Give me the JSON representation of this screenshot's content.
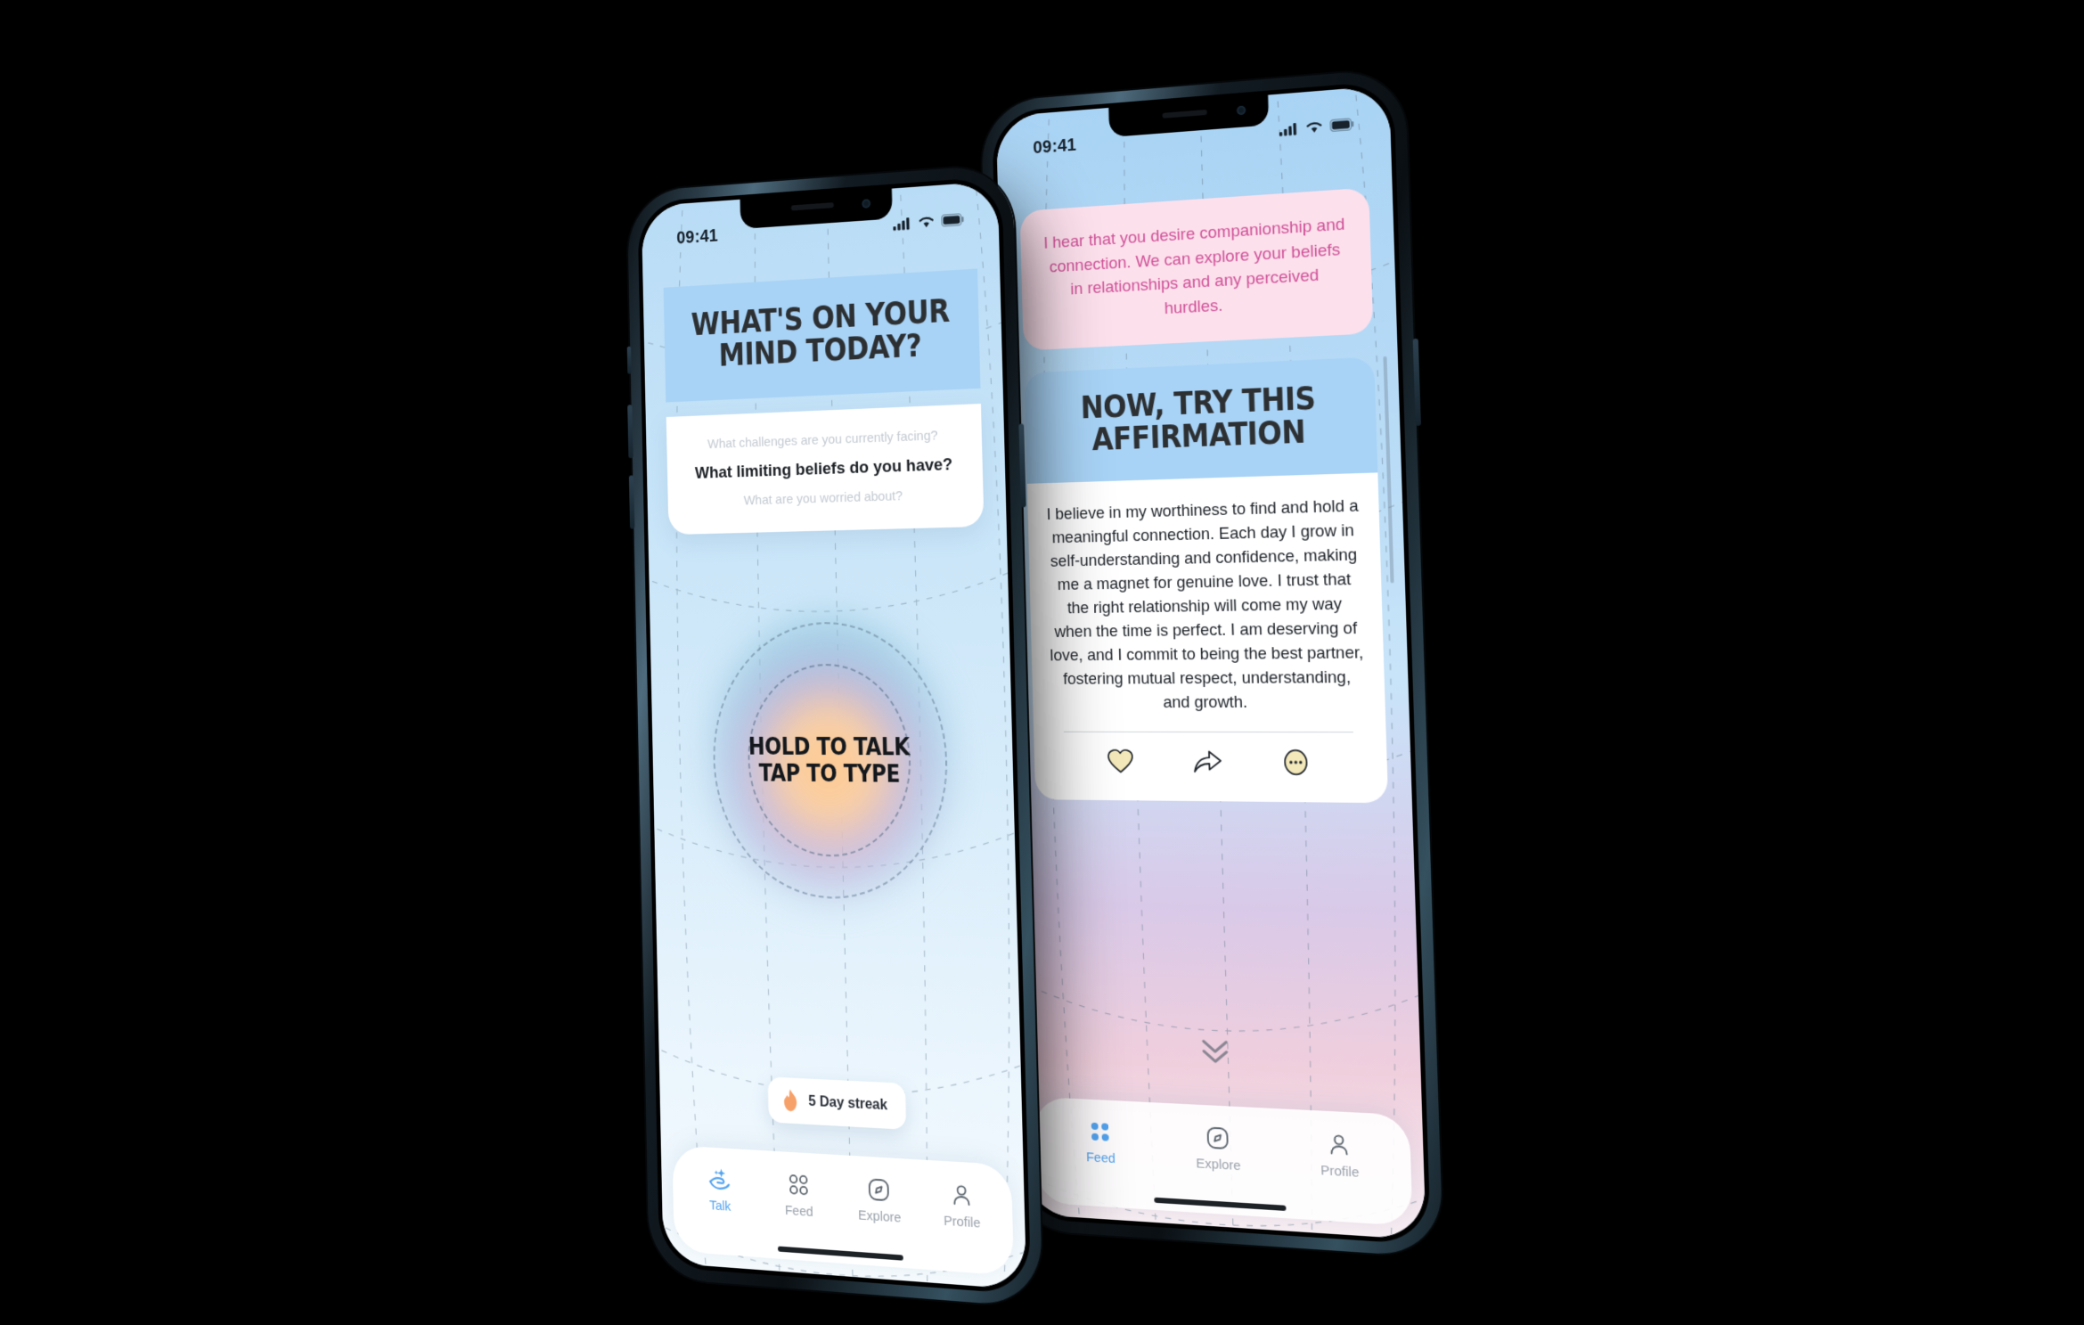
{
  "app": {
    "accent_blue": "#52a3ef",
    "card_blue": "#a8d3f6",
    "pink_card_bg": "#fce0ec",
    "pink_text": "#cf4f97",
    "streak_orange": "#f7a16a"
  },
  "status_bar": {
    "time": "09:41",
    "cellular_icon": "cellular-bars-icon",
    "wifi_icon": "wifi-icon",
    "battery_icon": "battery-icon"
  },
  "talk_screen": {
    "header_title": "WHAT'S ON YOUR MIND TODAY?",
    "questions": [
      {
        "text": "What challenges are you currently facing?",
        "active": false
      },
      {
        "text": "What limiting beliefs do you have?",
        "active": true
      },
      {
        "text": "What are you worried about?",
        "active": false
      }
    ],
    "orb": {
      "line1": "HOLD TO TALK",
      "line2": "TAP TO TYPE"
    },
    "streak": {
      "icon": "flame-icon",
      "label": "5 Day streak"
    },
    "tabs": [
      {
        "label": "Talk",
        "icon": "sparkle-hand-icon",
        "active": true
      },
      {
        "label": "Feed",
        "icon": "grid-dots-icon",
        "active": false
      },
      {
        "label": "Explore",
        "icon": "compass-icon",
        "active": false
      },
      {
        "label": "Profile",
        "icon": "person-icon",
        "active": false
      }
    ]
  },
  "feed_screen": {
    "insight_card": "I hear that you desire companionship and connection. We can explore your beliefs in relationships and any perceived hurdles.",
    "affirmation_header": "NOW, TRY THIS AFFIRMATION",
    "affirmation_body": "I believe in my worthiness to find and hold a meaningful connection. Each day I grow in self-understanding and confidence, making me a magnet for genuine love. I trust that the right relationship will come my way when the time is perfect. I am deserving of love, and I commit to being the best partner, fostering mutual respect, understanding, and growth.",
    "actions": [
      {
        "name": "like",
        "icon": "heart-icon"
      },
      {
        "name": "share",
        "icon": "share-arrow-icon"
      },
      {
        "name": "more",
        "icon": "ellipsis-icon"
      }
    ],
    "scroll_hint_icon": "double-chevron-down-icon",
    "tabs": [
      {
        "label": "Feed",
        "icon": "grid-dots-icon",
        "active": true
      },
      {
        "label": "Explore",
        "icon": "compass-icon",
        "active": false
      },
      {
        "label": "Profile",
        "icon": "person-icon",
        "active": false
      }
    ]
  }
}
